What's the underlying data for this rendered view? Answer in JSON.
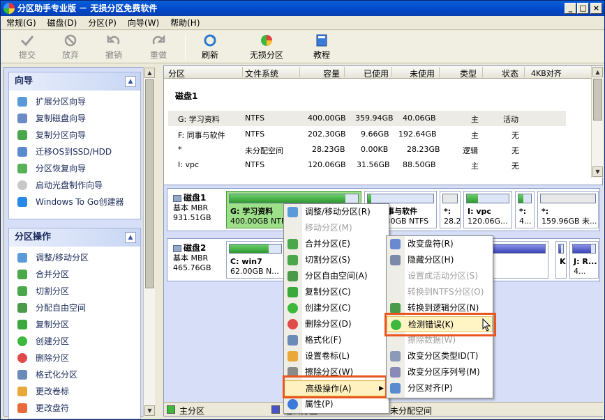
{
  "window": {
    "title": "分区助手专业版 － 无损分区免费软件",
    "controls": [
      "_",
      "□",
      "×"
    ]
  },
  "menubar": [
    "常规(G)",
    "磁盘(D)",
    "分区(P)",
    "向导(W)",
    "帮助(H)"
  ],
  "toolbar": {
    "commit": "提交",
    "discard": "放弃",
    "undo": "撤销",
    "redo": "重做",
    "refresh": "刷新",
    "lossless": "无损分区",
    "tutorial": "教程"
  },
  "wizard": {
    "title": "向导",
    "items": [
      "扩展分区向导",
      "复制磁盘向导",
      "复制分区向导",
      "迁移OS到SSD/HDD",
      "分区恢复向导",
      "启动光盘制作向导",
      "Windows To Go创建器"
    ]
  },
  "partops": {
    "title": "分区操作",
    "items": [
      "调整/移动分区",
      "合并分区",
      "切割分区",
      "分配自由空间",
      "复制分区",
      "创建分区",
      "删除分区",
      "格式化分区",
      "更改卷标",
      "更改盘符"
    ]
  },
  "table": {
    "headers": [
      "分区",
      "文件系统",
      "容量",
      "已使用",
      "未使用",
      "类型",
      "状态",
      "4KB对齐"
    ],
    "disk1_label": "磁盘1",
    "rows": [
      [
        "G: 学习资料",
        "NTFS",
        "400.00GB",
        "359.94GB",
        "40.06GB",
        "主",
        "活动"
      ],
      [
        "F: 同事与软件",
        "NTFS",
        "202.30GB",
        "9.66GB",
        "192.64GB",
        "主",
        "无"
      ],
      [
        "*",
        "未分配空间",
        "28.23GB",
        "0.00KB",
        "28.23GB",
        "逻辑",
        "无"
      ],
      [
        "I: vpc",
        "NTFS",
        "120.06GB",
        "31.56GB",
        "88.50GB",
        "主",
        "无"
      ]
    ]
  },
  "disks": [
    {
      "name": "磁盘1",
      "type": "基本 MBR",
      "size": "931.51GB"
    },
    {
      "name": "磁盘2",
      "type": "基本 MBR",
      "size": "465.76GB"
    }
  ],
  "disk1_parts": [
    {
      "name": "G: 学习资料",
      "info": "400.00GB NTFS",
      "used": 0.9
    },
    {
      "name": "F: 同事与软件",
      "info": "202.30GB NTFS",
      "used": 0.05
    },
    {
      "name": "*:",
      "info": "28.2...",
      "used": 0
    },
    {
      "name": "I: vpc",
      "info": "120.06G...",
      "used": 0.26
    },
    {
      "name": "*:",
      "info": "4...",
      "used": 0
    },
    {
      "name": "*:",
      "info": "159.96GB 未...",
      "used": 0
    }
  ],
  "disk2_parts": [
    {
      "name": "C: win7",
      "info": "62.00GB N...",
      "used": 0.75
    },
    {
      "name": "K",
      "info": "",
      "used": 0.5
    },
    {
      "name": "J: R...",
      "info": "4...",
      "used": 0.8
    }
  ],
  "legend": {
    "primary": "主分区",
    "logical": "逻辑分区",
    "unalloc": "未分配空间"
  },
  "context_menu": [
    "调整/移动分区(R)",
    "移动分区(M)",
    "合并分区(E)",
    "切割分区(S)",
    "分区自由空间(A)",
    "复制分区(C)",
    "创建分区(C)",
    "删除分区(D)",
    "格式化(F)",
    "设置卷标(L)",
    "擦除分区(W)",
    "高级操作(A)",
    "属性(P)"
  ],
  "submenu": [
    "改变盘符(R)",
    "隐藏分区(H)",
    "设置成活动分区(S)",
    "转换到NTFS分区(O)",
    "转换到逻辑分区(N)",
    "检测错误(K)",
    "擦除数据(W)",
    "改变分区类型ID(T)",
    "改变分区序列号(M)",
    "分区对齐(P)"
  ],
  "colors": {
    "primary": "#3cb83c",
    "logical": "#4a54c8",
    "highlight_box": "#e8571f"
  }
}
